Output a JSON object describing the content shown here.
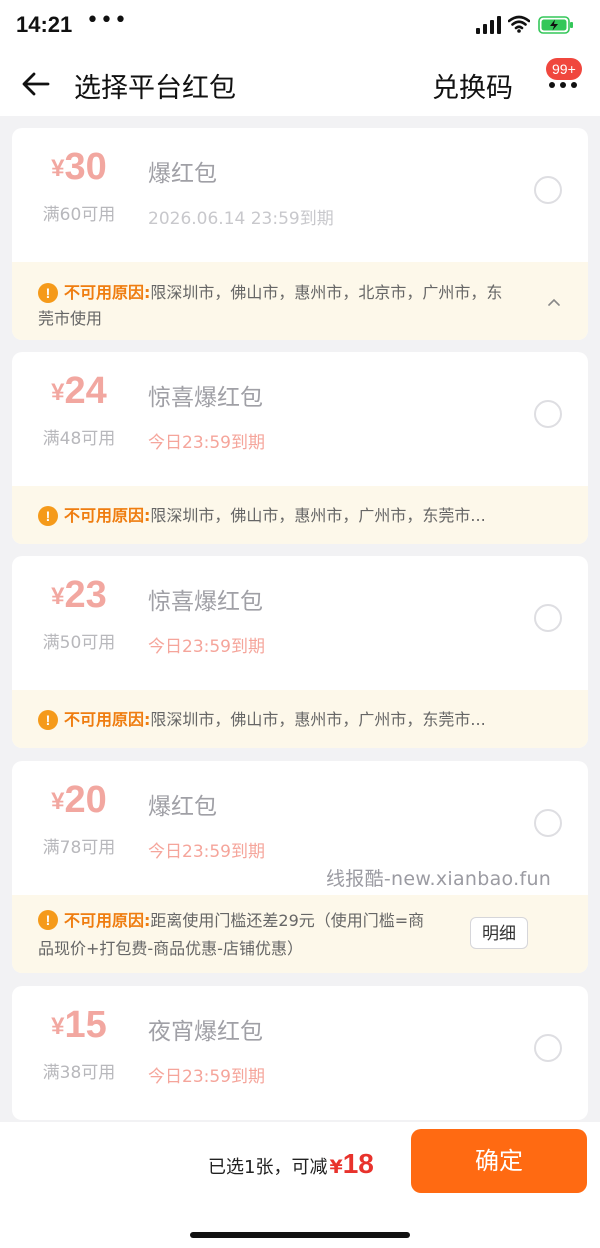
{
  "status_bar": {
    "time": "14:21",
    "dots": "•••"
  },
  "header": {
    "title": "选择平台红包",
    "redeem_code": "兑换码",
    "badge": "99+"
  },
  "coupons": [
    {
      "currency": "¥",
      "amount": "30",
      "threshold": "满60可用",
      "name": "爆红包",
      "expiry": "2026.06.14 23:59到期",
      "reason_label": "不可用原因:",
      "reason_text": "限深圳市，佛山市，惠州市，北京市，广州市，东",
      "reason_text2": "莞市使用"
    },
    {
      "currency": "¥",
      "amount": "24",
      "threshold": "满48可用",
      "name": "惊喜爆红包",
      "expiry": "今日23:59到期",
      "reason_label": "不可用原因:",
      "reason_text": "限深圳市，佛山市，惠州市，广州市，东莞市..."
    },
    {
      "currency": "¥",
      "amount": "23",
      "threshold": "满50可用",
      "name": "惊喜爆红包",
      "expiry": "今日23:59到期",
      "reason_label": "不可用原因:",
      "reason_text": "限深圳市，佛山市，惠州市，广州市，东莞市..."
    },
    {
      "currency": "¥",
      "amount": "20",
      "threshold": "满78可用",
      "name": "爆红包",
      "expiry": "今日23:59到期",
      "reason_label": "不可用原因:",
      "reason_text": "距离使用门槛还差29元（使用门槛=商",
      "reason_text2": "品现价+打包费-商品优惠-店铺优惠）",
      "detail_label": "明细"
    },
    {
      "currency": "¥",
      "amount": "15",
      "threshold": "满38可用",
      "name": "夜宵爆红包",
      "expiry": "今日23:59到期"
    }
  ],
  "watermark": "线报酷-new.xianbao.fun",
  "footer": {
    "summary_text": "已选1张，可减",
    "currency": "¥",
    "amount": "18",
    "confirm_label": "确定"
  },
  "colors": {
    "accent": "#ff6a12",
    "price_red": "#e8322c",
    "warning_orange": "#ef7d10"
  }
}
